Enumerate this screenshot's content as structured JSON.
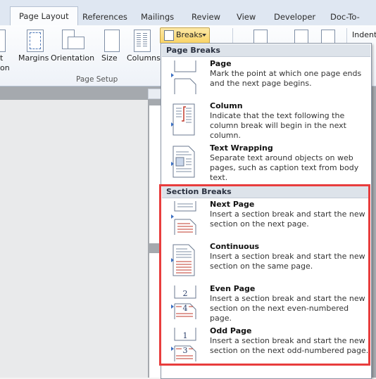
{
  "tabs": [
    {
      "label": "Page Layout",
      "active": true
    },
    {
      "label": "References",
      "active": false
    },
    {
      "label": "Mailings",
      "active": false
    },
    {
      "label": "Review",
      "active": false
    },
    {
      "label": "View",
      "active": false
    },
    {
      "label": "Developer",
      "active": false
    },
    {
      "label": "Doc-To-Help",
      "active": false
    }
  ],
  "ribbon": {
    "left_cut_label_1": "t",
    "left_cut_label_2": "on",
    "margins": "Margins",
    "orientation": "Orientation",
    "size": "Size",
    "columns": "Columns",
    "group_page_setup": "Page Setup",
    "breaks": "Breaks",
    "indent": "Indent"
  },
  "menu": {
    "page_breaks_header": "Page Breaks",
    "section_breaks_header": "Section Breaks",
    "page_breaks": [
      {
        "title": "Page",
        "desc": "Mark the point at which one page ends and the next page begins.",
        "icon": "page-break-icon"
      },
      {
        "title": "Column",
        "desc": "Indicate that the text following the column break will begin in the next column.",
        "icon": "column-break-icon"
      },
      {
        "title": "Text Wrapping",
        "desc": "Separate text around objects on web pages, such as caption text from body text.",
        "icon": "text-wrapping-icon"
      }
    ],
    "section_breaks": [
      {
        "title": "Next Page",
        "desc": "Insert a section break and start the new section on the next page.",
        "icon": "next-page-icon"
      },
      {
        "title": "Continuous",
        "desc": "Insert a section break and start the new section on the same page.",
        "icon": "continuous-icon"
      },
      {
        "title": "Even Page",
        "desc": "Insert a section break and start the new section on the next even-numbered page.",
        "icon": "even-page-icon",
        "num": "2",
        "num2": "4"
      },
      {
        "title": "Odd Page",
        "desc": "Insert a section break and start the new section on the next odd-numbered page.",
        "icon": "odd-page-icon",
        "num": "1",
        "num2": "3"
      }
    ]
  },
  "colors": {
    "highlight": "#e83d3d",
    "accent_line": "#c0392b"
  }
}
